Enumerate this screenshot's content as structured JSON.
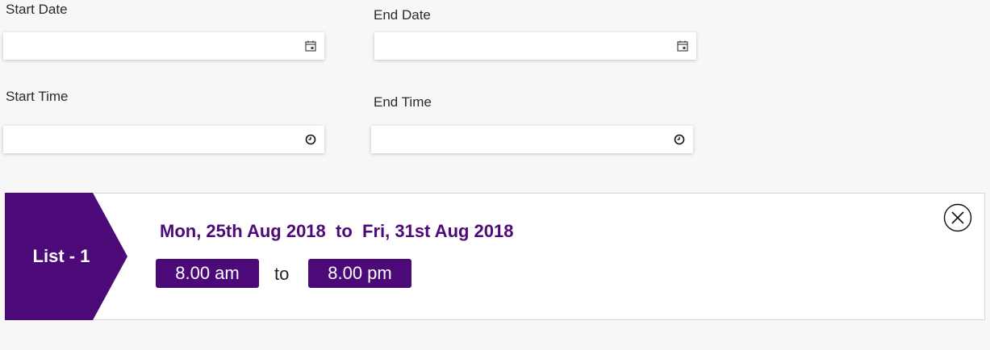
{
  "form": {
    "start_date": {
      "label": "Start Date",
      "value": "",
      "icon": "calendar-icon"
    },
    "end_date": {
      "label": "End Date",
      "value": "",
      "icon": "calendar-icon"
    },
    "start_time": {
      "label": "Start Time",
      "value": "",
      "icon": "clock-icon"
    },
    "end_time": {
      "label": "End Time",
      "value": "",
      "icon": "clock-icon"
    }
  },
  "list": {
    "tag_label": "List - 1",
    "date_from": "Mon, 25th Aug 2018",
    "date_sep": "to",
    "date_to": "Fri, 31st Aug 2018",
    "time_from": "8.00 am",
    "time_sep": "to",
    "time_to": "8.00 pm",
    "close_icon": "close-icon"
  },
  "colors": {
    "accent": "#4b0a78",
    "background": "#f7f7f7",
    "card": "#ffffff"
  }
}
